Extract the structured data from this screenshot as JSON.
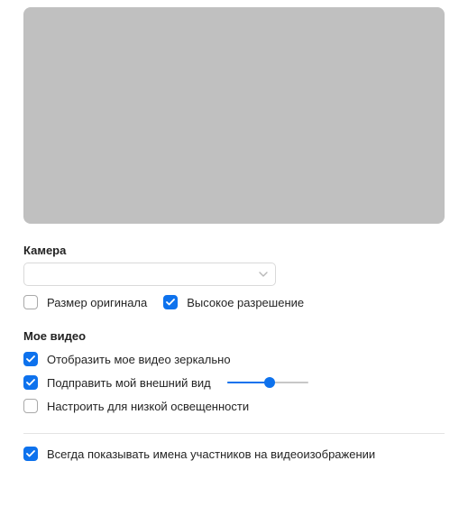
{
  "camera": {
    "label": "Камера",
    "selected": "",
    "original_size_label": "Размер оригинала",
    "original_size_checked": false,
    "hd_label": "Высокое разрешение",
    "hd_checked": true
  },
  "my_video": {
    "label": "Мое видео",
    "mirror_label": "Отобразить мое видео зеркально",
    "mirror_checked": true,
    "touch_up_label": "Подправить мой внешний вид",
    "touch_up_checked": true,
    "touch_up_slider_percent": 52,
    "low_light_label": "Настроить для низкой освещенности",
    "low_light_checked": false
  },
  "display": {
    "always_names_label": "Всегда показывать имена участников на видеоизображении",
    "always_names_checked": true
  }
}
